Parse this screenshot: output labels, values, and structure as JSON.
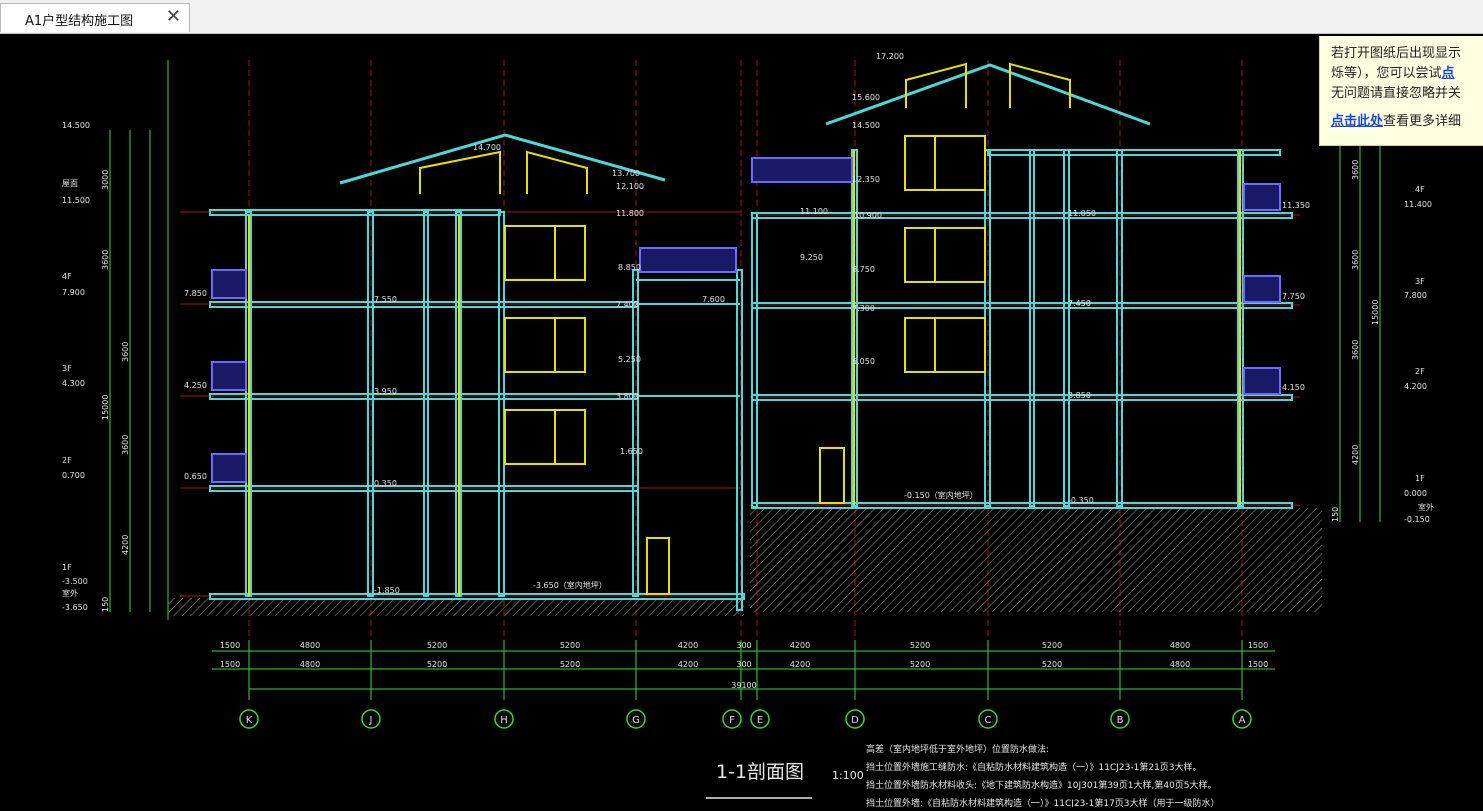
{
  "tab": {
    "title": "A1户型结构施工图",
    "close": "✕"
  },
  "notice": {
    "line1": "若打开图纸后出现显示",
    "line2a": "烁等），您可以尝试",
    "line2b": "点",
    "line3": "无问题请直接忽略并关",
    "more_link": "点击此处",
    "more_text": "查看更多详细"
  },
  "drawing": {
    "title": "1-1剖面图",
    "scale": "1:100",
    "axes": [
      "K",
      "J",
      "H",
      "G",
      "F",
      "E",
      "D",
      "C",
      "B",
      "A"
    ],
    "dims": [
      "1500",
      "4800",
      "5200",
      "5200",
      "4200",
      "300",
      "4200",
      "5200",
      "5200",
      "4800",
      "1500"
    ],
    "total": "39100",
    "left_levels": [
      {
        "label": "屋面",
        "value": "11.500"
      },
      {
        "label": "4F",
        "value": "7.900"
      },
      {
        "label": "3F",
        "value": "4.300"
      },
      {
        "label": "2F",
        "value": "0.700"
      },
      {
        "label": "1F",
        "value": "-3.500"
      },
      {
        "label": "室外",
        "value": "-3.650"
      }
    ],
    "left_top": "14.500",
    "right_levels": [
      {
        "label": "4F",
        "value": "11.400"
      },
      {
        "label": "3F",
        "value": "7.800"
      },
      {
        "label": "2F",
        "value": "4.200"
      },
      {
        "label": "1F",
        "value": "0.000"
      },
      {
        "label": "室外",
        "value": "-0.150"
      }
    ],
    "notes_title": "高差（室内地坪低于室外地坪）位置防水做法:",
    "notes": [
      "挡土位置外墙施工缝防水:《自粘防水材料建筑构造（一）》11CJ23-1第21页3大样。",
      "挡土位置外墙防水材料收头:《地下建筑防水构造》10J301第39页1大样,第40页5大样。",
      "挡土位置外墙:《自粘防水材料建筑构造（一）》11CJ23-1第17页3大样（用于一级防水）"
    ],
    "elevations": [
      "14.700",
      "13.700",
      "12.100",
      "11.800",
      "8.850",
      "7.400",
      "7.600",
      "7.550",
      "7.850",
      "5.250",
      "3.800",
      "3.950",
      "4.250",
      "1.650",
      "0.350",
      "0.650",
      "-1.850",
      "-3.650（室内地坪）",
      "17.200",
      "15.600",
      "14.500",
      "12.350",
      "11.100",
      "10.900",
      "11.050",
      "11.350",
      "9.250",
      "8.750",
      "7.300",
      "7.450",
      "7.750",
      "5.050",
      "3.850",
      "4.150",
      "-0.150（室内地坪）",
      "-0.350"
    ],
    "vert_dims_left": [
      "3000",
      "3600",
      "3600",
      "3600",
      "4200",
      "150"
    ],
    "vert_dims_right": [
      "3600",
      "3600",
      "3600",
      "4200",
      "150"
    ],
    "total_height": "15000"
  }
}
